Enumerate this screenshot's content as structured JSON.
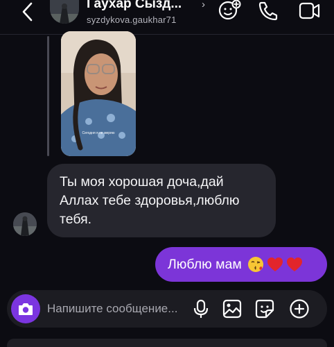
{
  "header": {
    "title": "Гаухар Сызд...",
    "title_chevron": "›",
    "username": "syzdykova.gaukhar71"
  },
  "messages": {
    "photo_caption": "Сегодня я не меряю",
    "incoming_text": "Ты моя хорошая доча,дай Аллах тебе здоровья,люблю тебя.",
    "outgoing_text": "Люблю мам",
    "outgoing_emojis": [
      "kissing-face",
      "red-heart",
      "red-heart"
    ]
  },
  "composer": {
    "placeholder": "Напишите сообщение..."
  },
  "colors": {
    "background": "#0c0c12",
    "incoming_bubble": "#26262e",
    "outgoing_bubble": "#7c35d8",
    "camera_button": "#7b35e0"
  },
  "icons": {
    "header": [
      "back-arrow-icon",
      "video-effects-icon",
      "phone-icon",
      "video-camera-icon"
    ],
    "composer": [
      "camera-icon",
      "microphone-icon",
      "gallery-icon",
      "sticker-icon",
      "plus-icon"
    ]
  }
}
